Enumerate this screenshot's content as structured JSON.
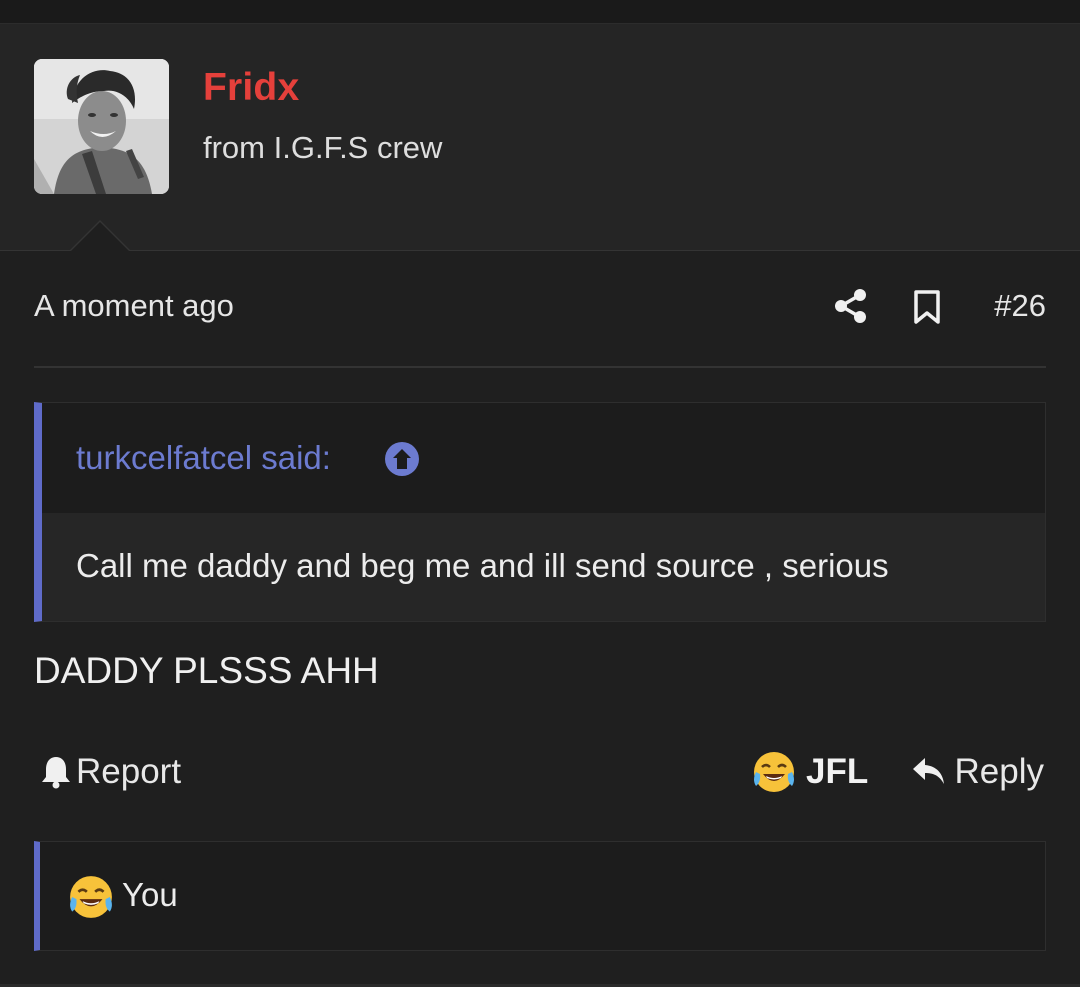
{
  "user": {
    "name": "Fridx",
    "title": "from I.G.F.S crew"
  },
  "post": {
    "timestamp": "A moment ago",
    "number": "#26",
    "quote": {
      "author": "turkcelfatcel said:",
      "text": "Call me daddy and beg me and ill send source , serious"
    },
    "message": "DADDY PLSSS AHH"
  },
  "actions": {
    "report_label": "Report",
    "reaction_label": "JFL",
    "reply_label": "Reply"
  },
  "reactions_summary": {
    "text": "You"
  },
  "colors": {
    "username": "#e5403b",
    "accent": "#5f6bc9",
    "background": "#1f1f1f"
  }
}
